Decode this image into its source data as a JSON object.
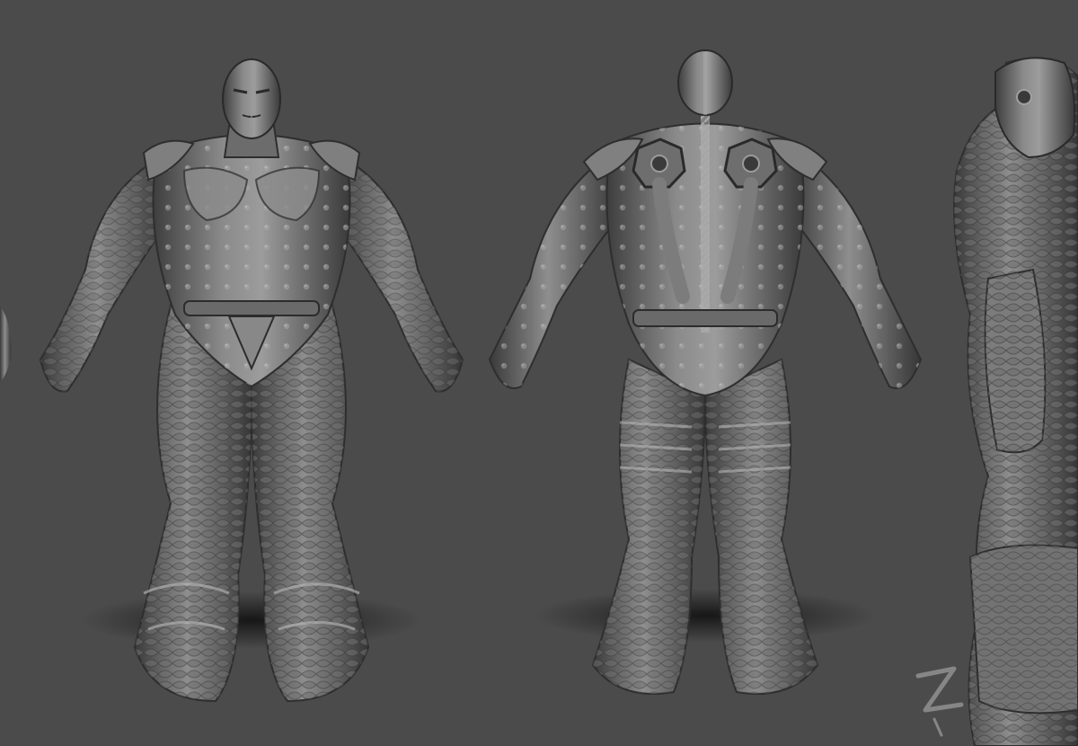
{
  "scene": {
    "background_color": "#4b4b4b",
    "figure_base_color": "#7a7a7a",
    "figure_highlight_color": "#b8b8b8",
    "figure_shadow_color": "#2e2e2e",
    "ground_shadow_color": "#1a1a1a",
    "views": [
      {
        "name": "front-view",
        "description_icon": "armored-figure-front"
      },
      {
        "name": "back-view",
        "description_icon": "armored-figure-back"
      },
      {
        "name": "side-view",
        "description_icon": "armored-figure-side-partial"
      }
    ]
  },
  "signature": {
    "icon": "artist-signature-mark"
  }
}
